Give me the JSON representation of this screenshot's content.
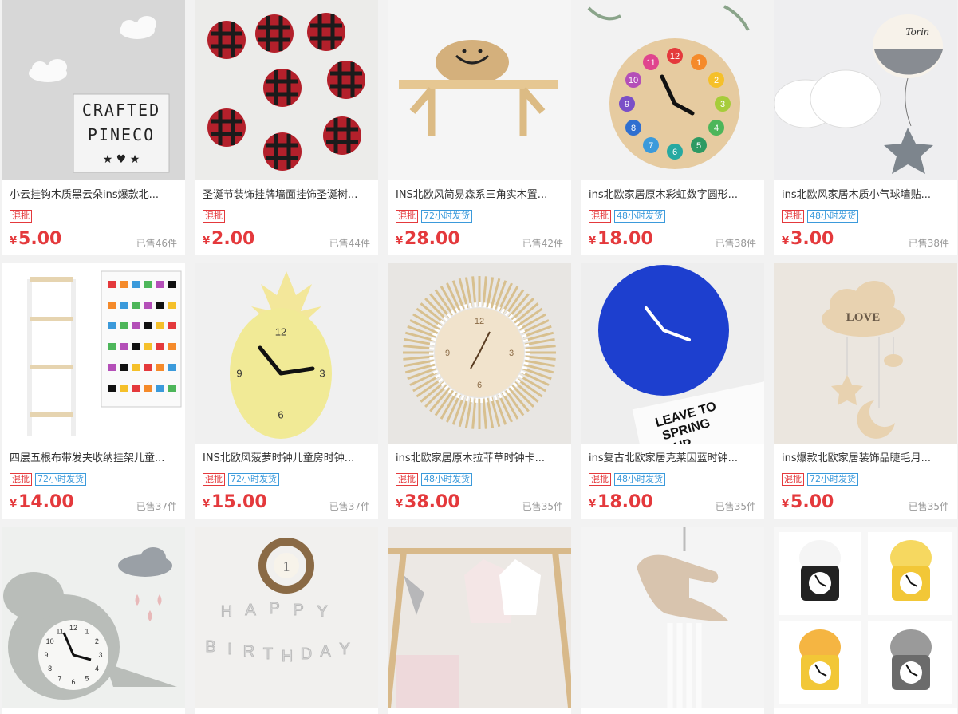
{
  "colors": {
    "accent": "#e4393c",
    "ship_tag": "#3b9adb",
    "muted": "#999999"
  },
  "currency": "¥",
  "products": [
    {
      "title": "小云挂钩木质黑云朵ins爆款北...",
      "tags": [
        "混批"
      ],
      "price": "5.00",
      "sold": "已售46件",
      "image": "cloud-hook-lightbox",
      "image_text": [
        "CRAFTED",
        "PINECO",
        "★ ♥ ★"
      ]
    },
    {
      "title": "圣诞节装饰挂牌墙面挂饰圣诞树...",
      "tags": [
        "混批"
      ],
      "price": "2.00",
      "sold": "已售44件",
      "image": "christmas-ornaments"
    },
    {
      "title": "INS北欧风简易森系三角实木置...",
      "tags": [
        "混批",
        "72小时发货"
      ],
      "price": "28.00",
      "sold": "已售42件",
      "image": "wood-shelf-basket"
    },
    {
      "title": "ins北欧家居原木彩虹数字圆形...",
      "tags": [
        "混批",
        "48小时发货"
      ],
      "price": "18.00",
      "sold": "已售38件",
      "image": "rainbow-number-clock",
      "image_text": [
        "12",
        "1",
        "2",
        "3",
        "4",
        "5",
        "6",
        "7",
        "8",
        "9",
        "10",
        "11"
      ]
    },
    {
      "title": "ins北欧风家居木质小气球墙贴...",
      "tags": [
        "混批",
        "48小时发货"
      ],
      "price": "3.00",
      "sold": "已售38件",
      "image": "balloon-cloud-decor",
      "image_text": [
        "Torin"
      ]
    },
    {
      "title": "四层五根布带发夹收纳挂架儿童...",
      "tags": [
        "混批",
        "72小时发货"
      ],
      "price": "14.00",
      "sold": "已售37件",
      "image": "hair-clip-hanger"
    },
    {
      "title": "INS北欧风菠萝时钟儿童房时钟...",
      "tags": [
        "混批",
        "72小时发货"
      ],
      "price": "15.00",
      "sold": "已售37件",
      "image": "pineapple-clock",
      "image_text": [
        "12",
        "3",
        "6",
        "9"
      ]
    },
    {
      "title": "ins北欧家居原木拉菲草时钟卡...",
      "tags": [
        "混批",
        "48小时发货"
      ],
      "price": "38.00",
      "sold": "已售35件",
      "image": "raffia-clock",
      "image_text": [
        "12",
        "3",
        "6",
        "9"
      ]
    },
    {
      "title": "ins复古北欧家居克莱因蓝时钟...",
      "tags": [
        "混批",
        "48小时发货"
      ],
      "price": "18.00",
      "sold": "已售35件",
      "image": "klein-blue-clock",
      "image_text": [
        "LEAVE TO",
        "SPRING",
        "UP"
      ]
    },
    {
      "title": "ins爆款北欧家居装饰品睫毛月...",
      "tags": [
        "混批",
        "72小时发货"
      ],
      "price": "5.00",
      "sold": "已售35件",
      "image": "cloud-moon-mobile",
      "image_text": [
        "LOVE"
      ]
    },
    {
      "title": "",
      "tags": [],
      "price": "",
      "sold": "",
      "image": "dinosaur-clock",
      "image_text": [
        "12",
        "1",
        "2",
        "3",
        "4",
        "5",
        "6",
        "7",
        "8",
        "9",
        "10",
        "11"
      ]
    },
    {
      "title": "",
      "tags": [],
      "price": "",
      "sold": "",
      "image": "birthday-wreath",
      "image_text": [
        "1",
        "HAPPY",
        "BIRTHDAY"
      ]
    },
    {
      "title": "",
      "tags": [],
      "price": "",
      "sold": "",
      "image": "clothes-rack"
    },
    {
      "title": "",
      "tags": [],
      "price": "",
      "sold": "",
      "image": "rocking-horse-hanger"
    },
    {
      "title": "",
      "tags": [],
      "price": "",
      "sold": "",
      "image": "animal-clocks"
    }
  ]
}
